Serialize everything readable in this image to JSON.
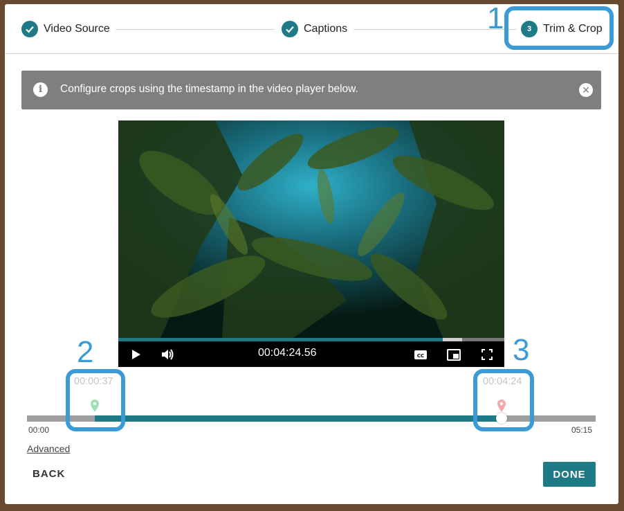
{
  "stepper": {
    "steps": [
      {
        "label": "Video Source",
        "state": "done"
      },
      {
        "label": "Captions",
        "state": "done"
      },
      {
        "label": "Trim & Crop",
        "number": "3",
        "state": "active"
      }
    ]
  },
  "banner": {
    "icon": "info-icon",
    "text": "Configure crops using the timestamp in the video player below.",
    "close_icon": "close-icon"
  },
  "player": {
    "current_time": "00:04:24.56",
    "progress_fraction": 0.84,
    "buffered_fraction": 0.89,
    "controls": [
      "play-icon",
      "volume-icon",
      "captions-icon",
      "picture-in-picture-icon",
      "fullscreen-icon"
    ]
  },
  "trim": {
    "start_label": "00:00:37",
    "end_label": "00:04:24",
    "start_fraction": 0.119,
    "end_fraction": 0.835,
    "timeline_start": "00:00",
    "timeline_end": "05:15",
    "colors": {
      "start_marker": "#9fe0b4",
      "end_marker": "#f4a7a7",
      "accent": "#1f7a87"
    }
  },
  "links": {
    "advanced": "Advanced"
  },
  "buttons": {
    "back": "BACK",
    "done": "DONE"
  },
  "annotations": [
    "1",
    "2",
    "3"
  ]
}
